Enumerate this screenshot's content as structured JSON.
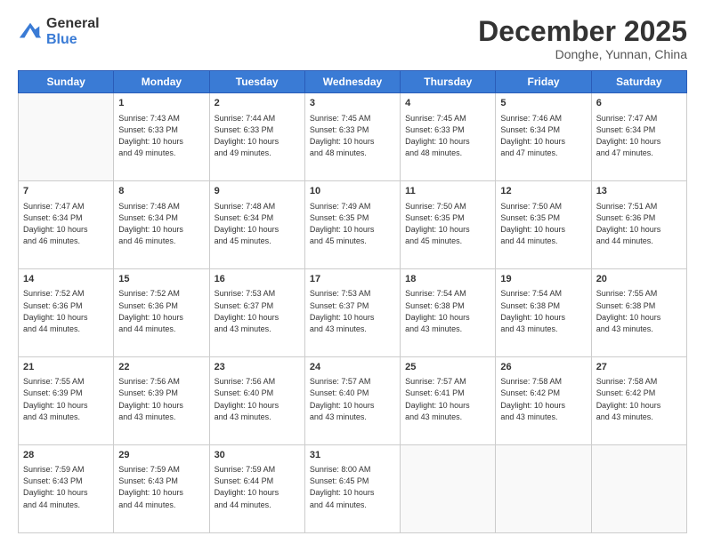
{
  "header": {
    "logo_general": "General",
    "logo_blue": "Blue",
    "month_title": "December 2025",
    "location": "Donghe, Yunnan, China"
  },
  "days_of_week": [
    "Sunday",
    "Monday",
    "Tuesday",
    "Wednesday",
    "Thursday",
    "Friday",
    "Saturday"
  ],
  "weeks": [
    [
      {
        "num": "",
        "info": ""
      },
      {
        "num": "1",
        "info": "Sunrise: 7:43 AM\nSunset: 6:33 PM\nDaylight: 10 hours\nand 49 minutes."
      },
      {
        "num": "2",
        "info": "Sunrise: 7:44 AM\nSunset: 6:33 PM\nDaylight: 10 hours\nand 49 minutes."
      },
      {
        "num": "3",
        "info": "Sunrise: 7:45 AM\nSunset: 6:33 PM\nDaylight: 10 hours\nand 48 minutes."
      },
      {
        "num": "4",
        "info": "Sunrise: 7:45 AM\nSunset: 6:33 PM\nDaylight: 10 hours\nand 48 minutes."
      },
      {
        "num": "5",
        "info": "Sunrise: 7:46 AM\nSunset: 6:34 PM\nDaylight: 10 hours\nand 47 minutes."
      },
      {
        "num": "6",
        "info": "Sunrise: 7:47 AM\nSunset: 6:34 PM\nDaylight: 10 hours\nand 47 minutes."
      }
    ],
    [
      {
        "num": "7",
        "info": "Sunrise: 7:47 AM\nSunset: 6:34 PM\nDaylight: 10 hours\nand 46 minutes."
      },
      {
        "num": "8",
        "info": "Sunrise: 7:48 AM\nSunset: 6:34 PM\nDaylight: 10 hours\nand 46 minutes."
      },
      {
        "num": "9",
        "info": "Sunrise: 7:48 AM\nSunset: 6:34 PM\nDaylight: 10 hours\nand 45 minutes."
      },
      {
        "num": "10",
        "info": "Sunrise: 7:49 AM\nSunset: 6:35 PM\nDaylight: 10 hours\nand 45 minutes."
      },
      {
        "num": "11",
        "info": "Sunrise: 7:50 AM\nSunset: 6:35 PM\nDaylight: 10 hours\nand 45 minutes."
      },
      {
        "num": "12",
        "info": "Sunrise: 7:50 AM\nSunset: 6:35 PM\nDaylight: 10 hours\nand 44 minutes."
      },
      {
        "num": "13",
        "info": "Sunrise: 7:51 AM\nSunset: 6:36 PM\nDaylight: 10 hours\nand 44 minutes."
      }
    ],
    [
      {
        "num": "14",
        "info": "Sunrise: 7:52 AM\nSunset: 6:36 PM\nDaylight: 10 hours\nand 44 minutes."
      },
      {
        "num": "15",
        "info": "Sunrise: 7:52 AM\nSunset: 6:36 PM\nDaylight: 10 hours\nand 44 minutes."
      },
      {
        "num": "16",
        "info": "Sunrise: 7:53 AM\nSunset: 6:37 PM\nDaylight: 10 hours\nand 43 minutes."
      },
      {
        "num": "17",
        "info": "Sunrise: 7:53 AM\nSunset: 6:37 PM\nDaylight: 10 hours\nand 43 minutes."
      },
      {
        "num": "18",
        "info": "Sunrise: 7:54 AM\nSunset: 6:38 PM\nDaylight: 10 hours\nand 43 minutes."
      },
      {
        "num": "19",
        "info": "Sunrise: 7:54 AM\nSunset: 6:38 PM\nDaylight: 10 hours\nand 43 minutes."
      },
      {
        "num": "20",
        "info": "Sunrise: 7:55 AM\nSunset: 6:38 PM\nDaylight: 10 hours\nand 43 minutes."
      }
    ],
    [
      {
        "num": "21",
        "info": "Sunrise: 7:55 AM\nSunset: 6:39 PM\nDaylight: 10 hours\nand 43 minutes."
      },
      {
        "num": "22",
        "info": "Sunrise: 7:56 AM\nSunset: 6:39 PM\nDaylight: 10 hours\nand 43 minutes."
      },
      {
        "num": "23",
        "info": "Sunrise: 7:56 AM\nSunset: 6:40 PM\nDaylight: 10 hours\nand 43 minutes."
      },
      {
        "num": "24",
        "info": "Sunrise: 7:57 AM\nSunset: 6:40 PM\nDaylight: 10 hours\nand 43 minutes."
      },
      {
        "num": "25",
        "info": "Sunrise: 7:57 AM\nSunset: 6:41 PM\nDaylight: 10 hours\nand 43 minutes."
      },
      {
        "num": "26",
        "info": "Sunrise: 7:58 AM\nSunset: 6:42 PM\nDaylight: 10 hours\nand 43 minutes."
      },
      {
        "num": "27",
        "info": "Sunrise: 7:58 AM\nSunset: 6:42 PM\nDaylight: 10 hours\nand 43 minutes."
      }
    ],
    [
      {
        "num": "28",
        "info": "Sunrise: 7:59 AM\nSunset: 6:43 PM\nDaylight: 10 hours\nand 44 minutes."
      },
      {
        "num": "29",
        "info": "Sunrise: 7:59 AM\nSunset: 6:43 PM\nDaylight: 10 hours\nand 44 minutes."
      },
      {
        "num": "30",
        "info": "Sunrise: 7:59 AM\nSunset: 6:44 PM\nDaylight: 10 hours\nand 44 minutes."
      },
      {
        "num": "31",
        "info": "Sunrise: 8:00 AM\nSunset: 6:45 PM\nDaylight: 10 hours\nand 44 minutes."
      },
      {
        "num": "",
        "info": ""
      },
      {
        "num": "",
        "info": ""
      },
      {
        "num": "",
        "info": ""
      }
    ]
  ]
}
